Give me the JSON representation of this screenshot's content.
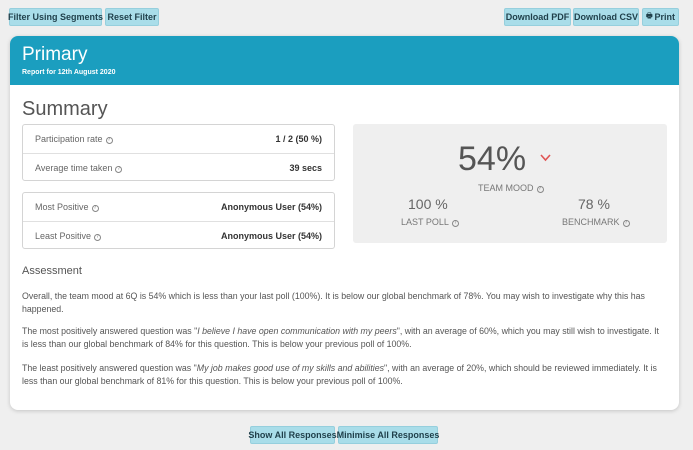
{
  "toolbar": {
    "filter_label": "Filter Using Segments",
    "reset_label": "Reset Filter",
    "download_pdf_label": "Download PDF",
    "download_csv_label": "Download CSV",
    "print_label": "Print"
  },
  "header": {
    "title": "Primary",
    "subtitle": "Report for 12th August 2020"
  },
  "summary": {
    "title": "Summary",
    "participation_label": "Participation rate",
    "participation_value": "1 / 2 (50 %)",
    "avg_time_label": "Average time taken",
    "avg_time_value": "39 secs",
    "most_positive_label": "Most Positive",
    "most_positive_value": "Anonymous User (54%)",
    "least_positive_label": "Least Positive",
    "least_positive_value": "Anonymous User (54%)"
  },
  "mood": {
    "value": "54%",
    "label": "TEAM MOOD",
    "last_poll_value": "100 %",
    "last_poll_label": "LAST POLL",
    "benchmark_value": "78 %",
    "benchmark_label": "BENCHMARK",
    "trend_color": "#e05555"
  },
  "assessment": {
    "title": "Assessment",
    "p1": "Overall, the team mood at 6Q is 54% which is less than your last poll (100%). It is below our global benchmark of 78%. You may wish to investigate why this has happened.",
    "p2_pre": "The most positively answered question was \"",
    "p2_q": "I believe I have open communication with my peers",
    "p2_post": "\", with an average of 60%, which you may still wish to investigate. It is less than our global benchmark of 84% for this question. This is below your previous poll of 100%.",
    "p3_pre": "The least positively answered question was \"",
    "p3_q": "My job makes good use of my skills and abilities",
    "p3_post": "\", with an average of 20%, which should be reviewed immediately. It is less than our global benchmark of 81% for this question. This is below your previous poll of 100%."
  },
  "footer": {
    "show_all_label": "Show All Responses",
    "minimise_all_label": "Minimise All Responses"
  },
  "colors": {
    "header_bg": "#1b9ebf",
    "button_bg": "#a9dde9"
  }
}
